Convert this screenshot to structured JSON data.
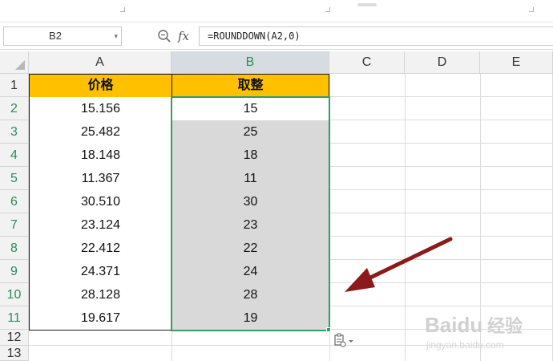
{
  "name_box": {
    "value": "B2"
  },
  "formula_bar": {
    "formula": "=ROUNDDOWN(A2,0)",
    "fx_label": "fx"
  },
  "columns": [
    "A",
    "B",
    "C",
    "D",
    "E"
  ],
  "rows": [
    "1",
    "2",
    "3",
    "4",
    "5",
    "6",
    "7",
    "8",
    "9",
    "10",
    "11",
    "12",
    "13"
  ],
  "table": {
    "headers": {
      "a": "价格",
      "b": "取整"
    },
    "prices": [
      "15.156",
      "25.482",
      "18.148",
      "11.367",
      "30.510",
      "23.124",
      "22.412",
      "24.371",
      "28.128",
      "19.617"
    ],
    "rounded": [
      "15",
      "25",
      "18",
      "11",
      "30",
      "23",
      "22",
      "24",
      "28",
      "19"
    ]
  },
  "selection": {
    "active_cell": "B2",
    "range": "B2:B11"
  },
  "colors": {
    "header_fill": "#ffc000",
    "selected_fill": "#d9d9d9",
    "selection_border": "#2e9e6a",
    "arrow": "#8b1a1a"
  },
  "watermark": {
    "brand": "Baidu",
    "brand_cn": "经验",
    "url": "jingyan.baidu.com"
  }
}
